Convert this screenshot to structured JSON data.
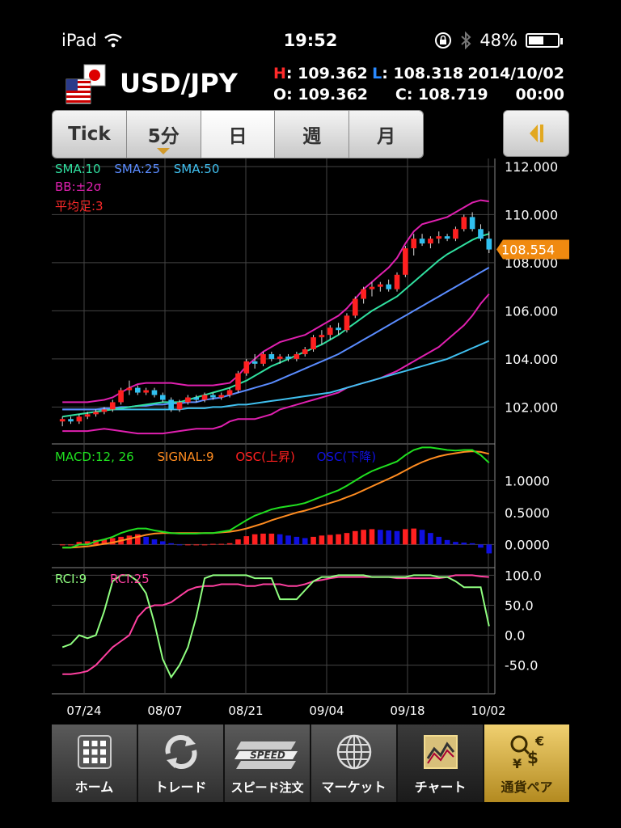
{
  "status": {
    "device": "iPad",
    "time": "19:52",
    "battery": "48%"
  },
  "header": {
    "pair": "USD/JPY",
    "h_label": "H",
    "h": "109.362",
    "l_label": "L",
    "l": "108.318",
    "date": "2014/10/02",
    "o_label": "O",
    "o": "109.362",
    "c_label": "C",
    "c": "108.719",
    "time": "00:00"
  },
  "tabs": [
    {
      "label": "Tick",
      "active": false
    },
    {
      "label": "5分",
      "active": false
    },
    {
      "label": "日",
      "active": true
    },
    {
      "label": "週",
      "active": false
    },
    {
      "label": "月",
      "active": false
    }
  ],
  "legends": {
    "sma10": "SMA:10",
    "sma25": "SMA:25",
    "sma50": "SMA:50",
    "bb": "BB:±2σ",
    "heikin": "平均足:3",
    "macd": "MACD:12, 26",
    "signal": "SIGNAL:9",
    "osc_up": "OSC(上昇)",
    "osc_down": "OSC(下降)",
    "rci9": "RCI:9",
    "rci25": "RCI:25"
  },
  "colors": {
    "sma10": "#30e0a0",
    "sma25": "#5a8cff",
    "sma50": "#40c0f0",
    "bb": "#e020b0",
    "up": "#ff2020",
    "down": "#30c0f0",
    "macd": "#20e020",
    "signal": "#ff8c20",
    "osc_up": "#ff2020",
    "osc_down": "#1010e0",
    "rci9": "#90ff80",
    "rci25": "#ff40a0",
    "price_tag": "#f08a10"
  },
  "chart_data": [
    {
      "type": "candlestick",
      "ylim": [
        100.5,
        112.2
      ],
      "yticks": [
        "112.000",
        "110.000",
        "108.000",
        "106.000",
        "104.000",
        "102.000"
      ],
      "ytick_values": [
        112,
        110,
        108,
        106,
        104,
        102
      ],
      "current_price": "108.554",
      "candles": [
        [
          101.4,
          101.6,
          101.2,
          101.5
        ],
        [
          101.5,
          101.6,
          101.3,
          101.4
        ],
        [
          101.4,
          101.7,
          101.3,
          101.6
        ],
        [
          101.6,
          101.8,
          101.5,
          101.7
        ],
        [
          101.7,
          101.9,
          101.6,
          101.8
        ],
        [
          101.8,
          102.0,
          101.7,
          101.9
        ],
        [
          101.9,
          102.3,
          101.8,
          102.2
        ],
        [
          102.2,
          102.8,
          102.1,
          102.7
        ],
        [
          102.7,
          103.1,
          102.5,
          102.8
        ],
        [
          102.8,
          102.9,
          102.5,
          102.6
        ],
        [
          102.6,
          102.8,
          102.5,
          102.7
        ],
        [
          102.7,
          102.8,
          102.4,
          102.5
        ],
        [
          102.5,
          102.6,
          102.2,
          102.3
        ],
        [
          102.3,
          102.4,
          101.8,
          101.9
        ],
        [
          101.9,
          102.3,
          101.8,
          102.2
        ],
        [
          102.2,
          102.5,
          102.1,
          102.4
        ],
        [
          102.4,
          102.5,
          102.2,
          102.3
        ],
        [
          102.3,
          102.6,
          102.2,
          102.5
        ],
        [
          102.5,
          102.6,
          102.3,
          102.4
        ],
        [
          102.4,
          102.6,
          102.3,
          102.5
        ],
        [
          102.5,
          102.8,
          102.4,
          102.7
        ],
        [
          102.7,
          103.5,
          102.6,
          103.4
        ],
        [
          103.4,
          104.0,
          103.3,
          103.9
        ],
        [
          103.9,
          104.2,
          103.6,
          103.8
        ],
        [
          103.8,
          104.3,
          103.7,
          104.2
        ],
        [
          104.2,
          104.3,
          103.9,
          104.0
        ],
        [
          104.0,
          104.2,
          103.8,
          104.1
        ],
        [
          104.1,
          104.2,
          103.9,
          104.0
        ],
        [
          104.0,
          104.3,
          103.9,
          104.2
        ],
        [
          104.2,
          104.5,
          104.1,
          104.4
        ],
        [
          104.4,
          105.0,
          104.3,
          104.9
        ],
        [
          104.9,
          105.2,
          104.6,
          105.0
        ],
        [
          105.0,
          105.4,
          104.8,
          105.3
        ],
        [
          105.3,
          105.5,
          105.0,
          105.2
        ],
        [
          105.2,
          105.9,
          105.1,
          105.8
        ],
        [
          105.8,
          106.6,
          105.7,
          106.5
        ],
        [
          106.5,
          107.0,
          106.3,
          106.9
        ],
        [
          106.9,
          107.2,
          106.6,
          107.0
        ],
        [
          107.0,
          107.2,
          106.8,
          107.1
        ],
        [
          107.1,
          107.3,
          106.8,
          106.9
        ],
        [
          106.9,
          107.6,
          106.8,
          107.5
        ],
        [
          107.5,
          108.7,
          107.4,
          108.6
        ],
        [
          108.6,
          109.2,
          108.3,
          109.0
        ],
        [
          109.0,
          109.2,
          108.7,
          108.8
        ],
        [
          108.8,
          109.1,
          108.6,
          109.0
        ],
        [
          109.0,
          109.3,
          108.8,
          109.1
        ],
        [
          109.1,
          109.2,
          108.9,
          109.0
        ],
        [
          109.0,
          109.5,
          108.9,
          109.4
        ],
        [
          109.4,
          110.0,
          109.3,
          109.9
        ],
        [
          109.9,
          110.1,
          109.3,
          109.4
        ],
        [
          109.4,
          109.6,
          108.9,
          109.0
        ],
        [
          109.0,
          109.3,
          108.4,
          108.55
        ]
      ],
      "sma10": [
        101.6,
        101.65,
        101.7,
        101.75,
        101.8,
        101.85,
        101.9,
        101.95,
        102.0,
        102.05,
        102.1,
        102.15,
        102.2,
        102.2,
        102.2,
        102.3,
        102.4,
        102.5,
        102.6,
        102.7,
        102.8,
        102.95,
        103.1,
        103.3,
        103.5,
        103.7,
        103.85,
        104.0,
        104.15,
        104.3,
        104.45,
        104.6,
        104.8,
        105.0,
        105.25,
        105.5,
        105.75,
        106.0,
        106.2,
        106.4,
        106.6,
        106.9,
        107.2,
        107.5,
        107.8,
        108.1,
        108.35,
        108.55,
        108.75,
        108.95,
        109.1,
        109.2
      ],
      "sma25": [
        101.9,
        101.9,
        101.9,
        101.9,
        101.9,
        101.95,
        101.95,
        102.0,
        102.0,
        102.05,
        102.05,
        102.1,
        102.1,
        102.15,
        102.15,
        102.2,
        102.2,
        102.3,
        102.35,
        102.4,
        102.5,
        102.6,
        102.7,
        102.8,
        102.9,
        103.0,
        103.15,
        103.3,
        103.45,
        103.6,
        103.75,
        103.9,
        104.05,
        104.2,
        104.4,
        104.6,
        104.8,
        105.0,
        105.2,
        105.4,
        105.6,
        105.8,
        106.0,
        106.2,
        106.4,
        106.6,
        106.8,
        107.0,
        107.2,
        107.4,
        107.6,
        107.8
      ],
      "sma50": [
        101.9,
        101.9,
        101.9,
        101.9,
        101.9,
        101.9,
        101.9,
        101.9,
        101.9,
        101.9,
        101.9,
        101.9,
        101.9,
        101.9,
        101.9,
        101.95,
        101.95,
        101.95,
        102.0,
        102.0,
        102.05,
        102.1,
        102.1,
        102.15,
        102.2,
        102.25,
        102.3,
        102.35,
        102.4,
        102.45,
        102.5,
        102.55,
        102.6,
        102.7,
        102.8,
        102.9,
        103.0,
        103.1,
        103.2,
        103.3,
        103.4,
        103.5,
        103.6,
        103.7,
        103.8,
        103.9,
        104.0,
        104.15,
        104.3,
        104.45,
        104.6,
        104.75
      ],
      "bb_upper": [
        102.2,
        102.2,
        102.2,
        102.2,
        102.25,
        102.3,
        102.4,
        102.6,
        102.8,
        102.95,
        103.0,
        103.0,
        103.0,
        103.0,
        102.95,
        102.9,
        102.9,
        102.9,
        102.9,
        102.95,
        103.0,
        103.3,
        103.7,
        104.0,
        104.3,
        104.5,
        104.7,
        104.8,
        104.9,
        105.0,
        105.2,
        105.4,
        105.6,
        105.8,
        106.1,
        106.5,
        106.9,
        107.2,
        107.5,
        107.8,
        108.2,
        108.8,
        109.3,
        109.6,
        109.7,
        109.8,
        109.9,
        110.1,
        110.3,
        110.5,
        110.6,
        110.55
      ],
      "bb_lower": [
        101.0,
        101.0,
        101.0,
        101.0,
        101.05,
        101.1,
        101.05,
        101.0,
        100.95,
        100.9,
        100.9,
        100.9,
        100.9,
        100.95,
        101.0,
        101.05,
        101.1,
        101.1,
        101.1,
        101.2,
        101.4,
        101.5,
        101.5,
        101.5,
        101.6,
        101.7,
        101.9,
        102.0,
        102.1,
        102.2,
        102.3,
        102.4,
        102.5,
        102.6,
        102.8,
        102.9,
        103.0,
        103.1,
        103.2,
        103.35,
        103.5,
        103.7,
        103.9,
        104.1,
        104.3,
        104.5,
        104.8,
        105.1,
        105.4,
        105.8,
        106.3,
        106.7
      ]
    },
    {
      "type": "macd",
      "ylim": [
        -0.35,
        1.55
      ],
      "yticks": [
        "1.0000",
        "0.5000",
        "0.0000"
      ],
      "ytick_values": [
        1.0,
        0.5,
        0.0
      ],
      "macd": [
        -0.05,
        -0.05,
        0.0,
        0.0,
        0.05,
        0.08,
        0.12,
        0.18,
        0.22,
        0.25,
        0.25,
        0.22,
        0.2,
        0.18,
        0.17,
        0.17,
        0.17,
        0.18,
        0.18,
        0.2,
        0.22,
        0.3,
        0.38,
        0.45,
        0.5,
        0.55,
        0.58,
        0.6,
        0.62,
        0.65,
        0.7,
        0.75,
        0.8,
        0.85,
        0.92,
        1.0,
        1.08,
        1.15,
        1.2,
        1.25,
        1.3,
        1.4,
        1.48,
        1.52,
        1.52,
        1.5,
        1.48,
        1.47,
        1.48,
        1.48,
        1.4,
        1.28
      ],
      "signal": [
        -0.05,
        -0.05,
        -0.04,
        -0.03,
        -0.01,
        0.01,
        0.03,
        0.06,
        0.09,
        0.12,
        0.15,
        0.17,
        0.18,
        0.18,
        0.18,
        0.18,
        0.18,
        0.18,
        0.18,
        0.19,
        0.2,
        0.22,
        0.25,
        0.29,
        0.33,
        0.38,
        0.42,
        0.46,
        0.5,
        0.53,
        0.57,
        0.61,
        0.65,
        0.69,
        0.74,
        0.79,
        0.85,
        0.91,
        0.97,
        1.03,
        1.09,
        1.16,
        1.23,
        1.29,
        1.34,
        1.38,
        1.41,
        1.43,
        1.45,
        1.46,
        1.45,
        1.42
      ],
      "osc": [
        0.0,
        0.0,
        0.04,
        0.05,
        0.07,
        0.08,
        0.1,
        0.12,
        0.14,
        0.16,
        0.12,
        0.08,
        0.05,
        0.02,
        -0.01,
        -0.01,
        -0.01,
        0.0,
        0.01,
        0.01,
        0.02,
        0.08,
        0.13,
        0.16,
        0.17,
        0.17,
        0.16,
        0.14,
        0.12,
        0.1,
        0.12,
        0.14,
        0.15,
        0.16,
        0.18,
        0.21,
        0.23,
        0.24,
        0.23,
        0.22,
        0.21,
        0.24,
        0.25,
        0.23,
        0.18,
        0.12,
        0.07,
        0.04,
        0.03,
        0.02,
        -0.05,
        -0.14
      ]
    },
    {
      "type": "rci",
      "ylim": [
        -95,
        110
      ],
      "yticks": [
        "100.0",
        "50.0",
        "0.0",
        "-50.0"
      ],
      "ytick_values": [
        100,
        50,
        0,
        -50
      ],
      "rci9": [
        -20,
        -15,
        0,
        -5,
        0,
        40,
        90,
        100,
        100,
        90,
        70,
        20,
        -40,
        -70,
        -50,
        -20,
        30,
        95,
        100,
        100,
        100,
        100,
        100,
        95,
        95,
        95,
        60,
        60,
        60,
        75,
        90,
        97,
        97,
        100,
        100,
        100,
        100,
        97,
        97,
        97,
        97,
        97,
        100,
        100,
        100,
        97,
        97,
        90,
        80,
        80,
        80,
        15
      ],
      "rci25": [
        -65,
        -65,
        -63,
        -60,
        -50,
        -35,
        -20,
        -10,
        0,
        30,
        45,
        50,
        50,
        55,
        65,
        75,
        80,
        82,
        82,
        85,
        85,
        85,
        82,
        82,
        85,
        85,
        85,
        82,
        82,
        85,
        90,
        92,
        95,
        97,
        97,
        97,
        97,
        97,
        97,
        97,
        95,
        95,
        95,
        95,
        95,
        95,
        97,
        100,
        100,
        100,
        98,
        97
      ]
    }
  ],
  "xlabels": [
    "07/24",
    "08/07",
    "08/21",
    "09/04",
    "09/18",
    "10/02"
  ],
  "tabbar": [
    {
      "label": "ホーム",
      "icon": "home-grid-icon"
    },
    {
      "label": "トレード",
      "icon": "trade-arrows-icon"
    },
    {
      "label": "スピード注文",
      "icon": "speed-icon",
      "icon_text": "SPEED"
    },
    {
      "label": "マーケット",
      "icon": "globe-icon"
    },
    {
      "label": "チャート",
      "icon": "chart-icon",
      "active": true
    },
    {
      "label": "通貨ペア",
      "icon": "currency-icon"
    }
  ]
}
